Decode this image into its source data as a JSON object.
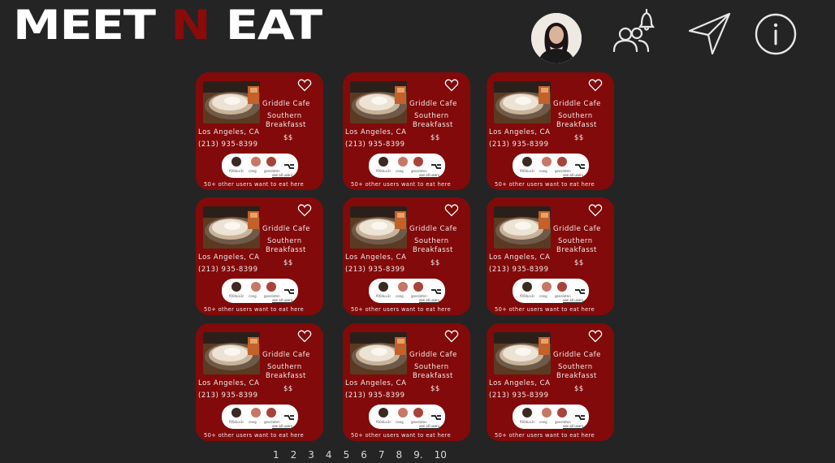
{
  "brand": {
    "part1": "MEET ",
    "part2": "N",
    "part3": " EAT"
  },
  "nav": {
    "profile": "profile-avatar",
    "icons": [
      "friends-bell-icon",
      "send-icon",
      "info-icon"
    ]
  },
  "card_template": {
    "restaurant_name": "Griddle Cafe",
    "cuisine_line1": "Southern",
    "cuisine_line2": "Breakfasst",
    "city": "Los Angeles, CA",
    "phone": "(213) 935-8399",
    "price": "$$",
    "users": [
      "f00duv3r",
      "ceeg",
      "geeslaten"
    ],
    "see_all": "see all users",
    "others_text": "50+ other users want to eat here"
  },
  "cards": [
    {
      "id": 1
    },
    {
      "id": 2
    },
    {
      "id": 3
    },
    {
      "id": 4
    },
    {
      "id": 5
    },
    {
      "id": 6
    },
    {
      "id": 7
    },
    {
      "id": 8
    },
    {
      "id": 9
    }
  ],
  "pagination": [
    "1",
    "2",
    "3",
    "4",
    "5",
    "6",
    "7",
    "8",
    "9.",
    "10"
  ],
  "colors": {
    "background": "#242424",
    "card": "#820a0a",
    "accent": "#8b0b0b"
  }
}
